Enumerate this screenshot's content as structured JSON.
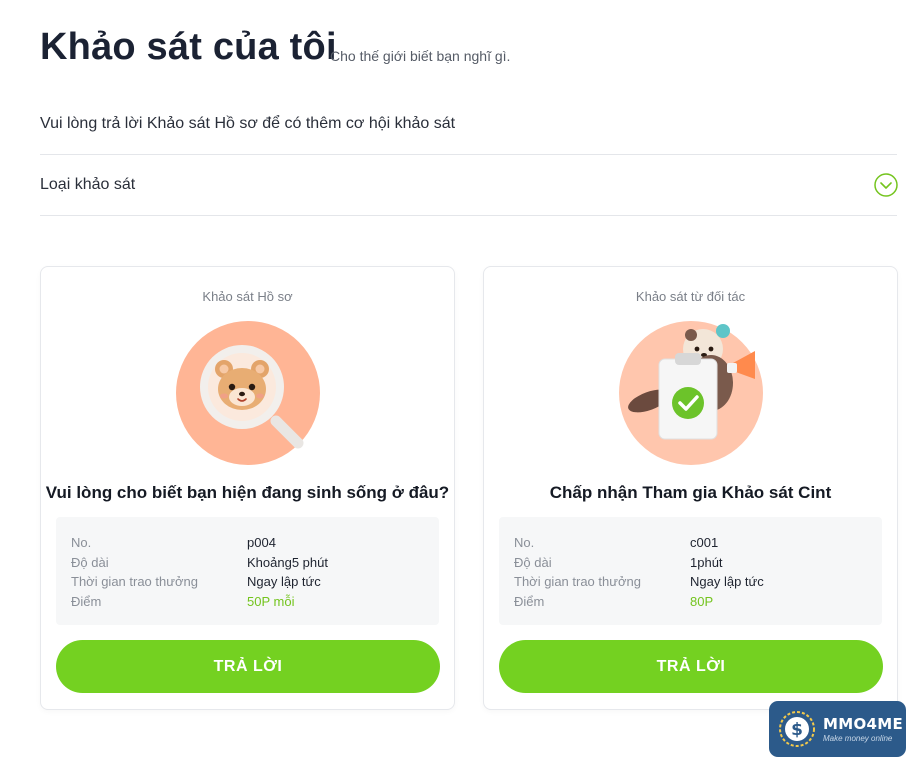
{
  "header": {
    "title": "Khảo sát của tôi",
    "subtitle": "Cho thế giới biết bạn nghĩ gì."
  },
  "notice": "Vui lòng trả lời Khảo sát Hồ sơ để có thêm cơ hội khảo sát",
  "filter": {
    "label": "Loại khảo sát",
    "icon": "chevron-down-circle-icon",
    "accent": "#74c41e"
  },
  "cards": [
    {
      "category": "Khảo sát Hồ sơ",
      "illustration": "bear-magnifier-illustration",
      "question": "Vui lòng cho biết bạn hiện đang sinh sống ở đâu?",
      "info": [
        {
          "key": "No.",
          "value": "p004"
        },
        {
          "key": "Độ dài",
          "value": "Khoảng5 phút"
        },
        {
          "key": "Thời gian trao thưởng",
          "value": "Ngay lập tức"
        },
        {
          "key": "Điểm",
          "value": "50P mỗi"
        }
      ],
      "button": "TRẢ LỜI"
    },
    {
      "category": "Khảo sát từ đối tác",
      "illustration": "otter-clipboard-illustration",
      "question": "Chấp nhận Tham gia Khảo sát Cint",
      "info": [
        {
          "key": "No.",
          "value": "c001"
        },
        {
          "key": "Độ dài",
          "value": "1phút"
        },
        {
          "key": "Thời gian trao thưởng",
          "value": "Ngay lập tức"
        },
        {
          "key": "Điểm",
          "value": "80P"
        }
      ],
      "button": "TRẢ LỜI"
    }
  ],
  "watermark": {
    "brand": "MMO4ME",
    "tagline": "Make money online"
  },
  "colors": {
    "button": "#74d121",
    "points": "#74c41e",
    "illustration_bg": "#ffb595"
  }
}
